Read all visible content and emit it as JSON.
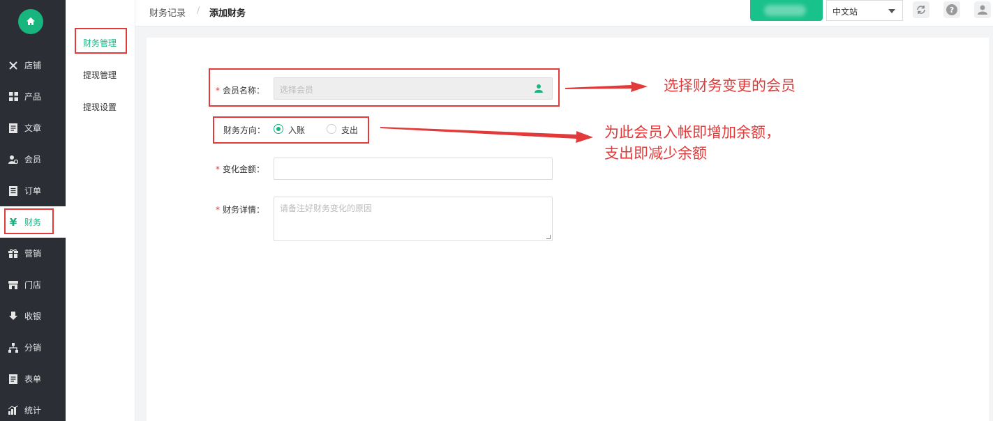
{
  "sidebar": {
    "items": [
      {
        "label": "店铺",
        "icon": "wrench-icon"
      },
      {
        "label": "产品",
        "icon": "grid-icon"
      },
      {
        "label": "文章",
        "icon": "document-icon"
      },
      {
        "label": "会员",
        "icon": "member-icon"
      },
      {
        "label": "订单",
        "icon": "list-icon"
      },
      {
        "label": "财务",
        "icon": "yen-icon"
      },
      {
        "label": "营销",
        "icon": "gift-icon"
      },
      {
        "label": "门店",
        "icon": "store-icon"
      },
      {
        "label": "收银",
        "icon": "download-icon"
      },
      {
        "label": "分销",
        "icon": "sitemap-icon"
      },
      {
        "label": "表单",
        "icon": "form-icon"
      },
      {
        "label": "统计",
        "icon": "chart-icon"
      }
    ],
    "active": "财务"
  },
  "subnav": {
    "items": [
      "财务管理",
      "提现管理",
      "提现设置"
    ],
    "active": "财务管理"
  },
  "breadcrumb": {
    "parent": "财务记录",
    "separator": "/",
    "current": "添加财务"
  },
  "header": {
    "language": "中文站"
  },
  "form": {
    "required_mark": "*",
    "member": {
      "label": "会员名称：",
      "placeholder": "选择会员"
    },
    "direction": {
      "label": "财务方向：",
      "options": [
        "入账",
        "支出"
      ],
      "selected": "入账"
    },
    "amount": {
      "label": "变化金额：",
      "value": ""
    },
    "detail": {
      "label": "财务详情：",
      "placeholder": "请备注好财务变化的原因"
    }
  },
  "annotations": {
    "member_note": "选择财务变更的会员",
    "direction_note_line1": "为此会员入帐即增加余额，",
    "direction_note_line2": "支出即减少余额"
  },
  "colors": {
    "accent": "#19b57f",
    "sidebar_bg": "#2b2e35",
    "annotation_red": "#e23a3a"
  }
}
